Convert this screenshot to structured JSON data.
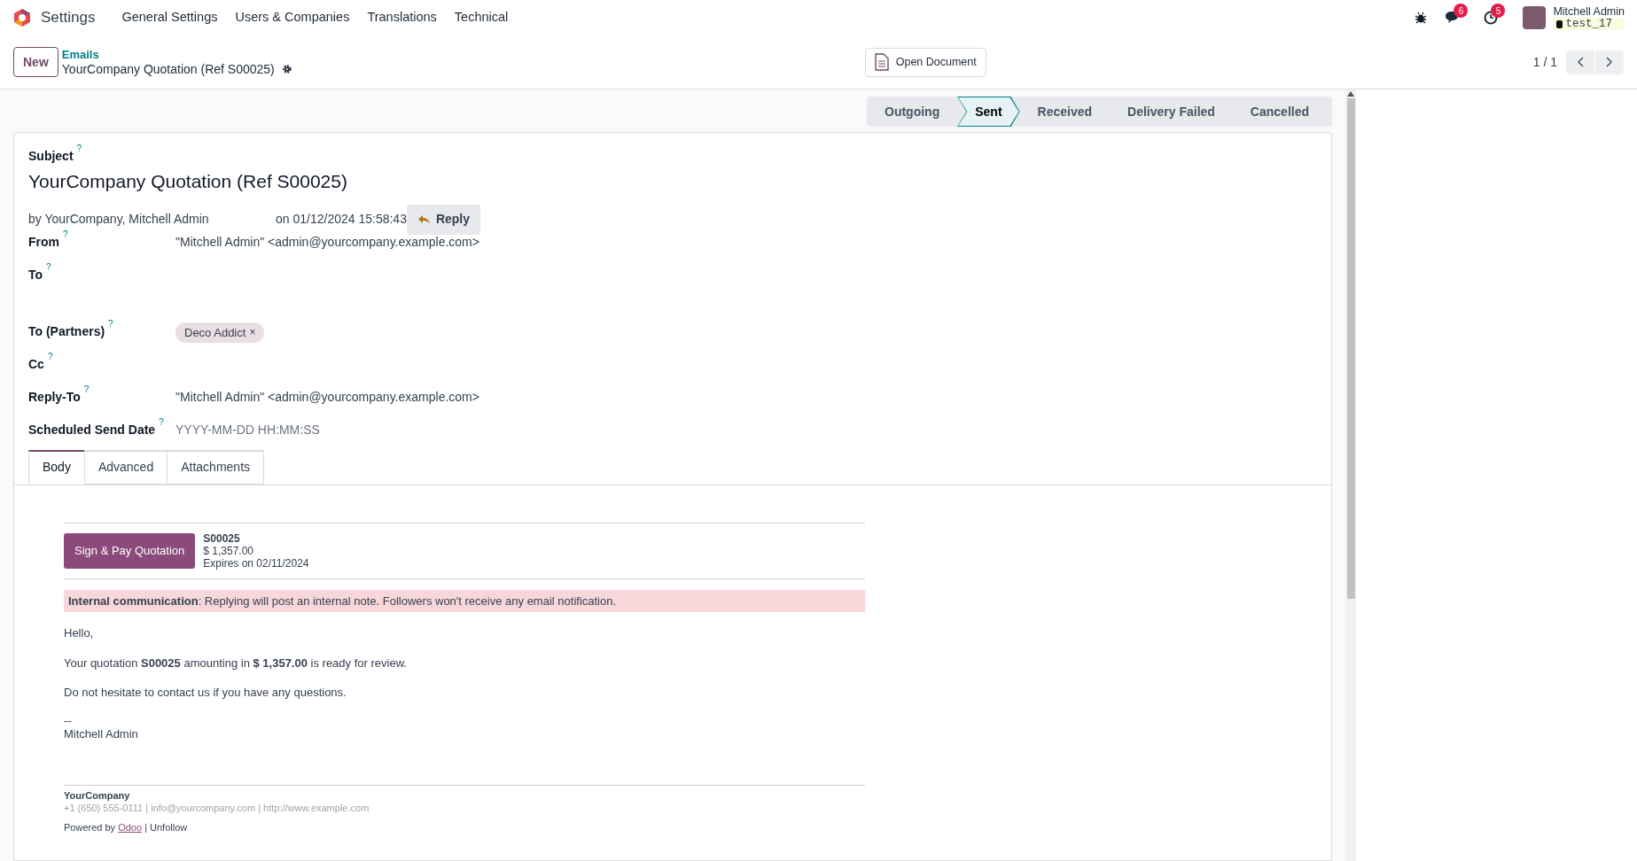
{
  "navbar": {
    "app": "Settings",
    "menus": [
      "General Settings",
      "Users & Companies",
      "Translations",
      "Technical"
    ],
    "messages_count": "6",
    "activities_count": "5",
    "user_name": "Mitchell Admin",
    "database": "test_17"
  },
  "control_panel": {
    "new_button": "New",
    "breadcrumb": "Emails",
    "record_title": "YourCompany Quotation (Ref S00025)",
    "open_document": "Open Document",
    "pager": "1 / 1"
  },
  "statusbar": [
    {
      "label": "Outgoing",
      "selected": false
    },
    {
      "label": "Sent",
      "selected": true
    },
    {
      "label": "Received",
      "selected": false
    },
    {
      "label": "Delivery Failed",
      "selected": false
    },
    {
      "label": "Cancelled",
      "selected": false
    }
  ],
  "form": {
    "subject_label": "Subject",
    "help": "?",
    "subject": "YourCompany Quotation (Ref S00025)",
    "author": "by YourCompany, Mitchell Admin",
    "date": "on 01/12/2024 15:58:43",
    "reply_button": "Reply",
    "fields": [
      {
        "label": "From",
        "help": "?",
        "kind": "text",
        "value": "\"Mitchell Admin\" <admin@yourcompany.example.com>"
      },
      {
        "label": "To",
        "help": "?",
        "kind": "empty"
      },
      {
        "label": "To (Partners)",
        "help": "?",
        "kind": "tags",
        "tags": [
          "Deco Addict"
        ],
        "remove": "×"
      },
      {
        "label": "Cc",
        "help": "?",
        "kind": "empty_short"
      },
      {
        "label": "Reply-To",
        "help": "?",
        "kind": "text",
        "value": "\"Mitchell Admin\" <admin@yourcompany.example.com>"
      },
      {
        "label": "Scheduled Send Date",
        "help": "?",
        "kind": "placeholder",
        "placeholder": "YYYY-MM-DD HH:MM:SS"
      }
    ]
  },
  "tabs": [
    {
      "label": "Body",
      "selected": true
    },
    {
      "label": "Advanced",
      "selected": false
    },
    {
      "label": "Attachments",
      "selected": false
    }
  ],
  "email": {
    "pay_button": "Sign & Pay Quotation",
    "order": "S00025",
    "amount": "$ 1,357.00",
    "expires": "Expires on 02/11/2024",
    "notice": "**Internal communication**: Replying will post an internal note. Followers won't receive any email notification.",
    "paragraphs": [
      "Hello,",
      "Your quotation **S00025** amounting in **$ 1,357.00** is ready for review.",
      "Do not hesitate to contact us if you have any questions."
    ],
    "signature_dash": "--",
    "signature": "Mitchell Admin",
    "company": "YourCompany",
    "contact": "+1 (650) 555-0111 | info@yourcompany.com | http://www.example.com",
    "powered_prefix": "Powered by",
    "powered_link": "Odoo",
    "powered_suffix": "| Unfollow"
  }
}
